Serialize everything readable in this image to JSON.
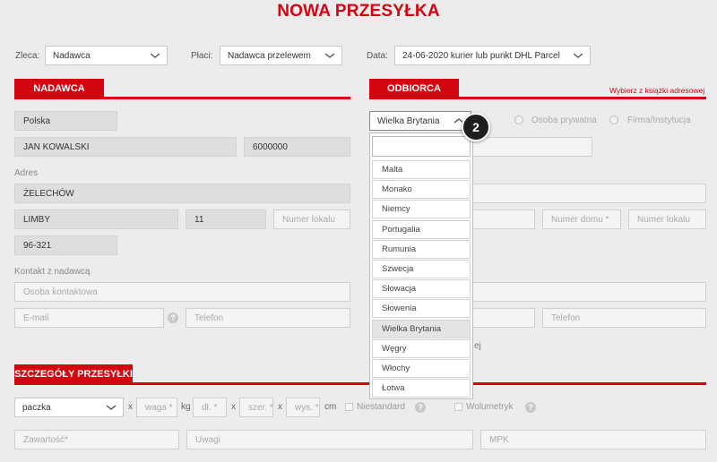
{
  "page_title": "NOWA PRZESYŁKA",
  "top": {
    "zleca_label": "Zleca:",
    "zleca_value": "Nadawca",
    "placi_label": "Płaci:",
    "placi_value": "Nadawca przelewem",
    "data_label": "Data:",
    "data_value": "24-06-2020 kurier lub punkt DHL Parcel"
  },
  "sender": {
    "header": "NADAWCA",
    "country": "Polska",
    "name": "JAN KOWALSKI",
    "phone_short": "6000000",
    "address_label": "Adres",
    "street": "ŻELECHÓW",
    "city": "LIMBY",
    "house_no": "11",
    "flat_placeholder": "Numer lokalu",
    "postal": "96-321",
    "contact_label": "Kontakt z nadawcą",
    "contact_person_placeholder": "Osoba kontaktowa",
    "email_placeholder": "E-mail",
    "phone_placeholder": "Telefon",
    "help_glyph": "?"
  },
  "receiver": {
    "header": "ODBIORCA",
    "address_book_link": "Wybierz z książki adresowej",
    "country_selected": "Wielka Brytania",
    "radio_private": "Osoba prywatna",
    "radio_company": "Firma/Instytucja",
    "house_placeholder": "Numer domu *",
    "flat_placeholder": "Numer lokalu",
    "phone_placeholder": "Telefon",
    "partial_text": "ej"
  },
  "country_dropdown": {
    "search_value": "",
    "options": [
      "Malta",
      "Monako",
      "Niemcy",
      "Portugalia",
      "Rumunia",
      "Szwecja",
      "Słowacja",
      "Słowenia",
      "Wielka Brytania",
      "Węgry",
      "Włochy",
      "Łotwa"
    ],
    "active_index": 8
  },
  "step_badge": "2",
  "details": {
    "header": "SZCZEGÓŁY PRZESYŁKI",
    "type_value": "paczka",
    "x_glyph": "x",
    "weight_placeholder": "waga *",
    "weight_unit": "kg",
    "length_placeholder": "dł. *",
    "width_placeholder": "szer. *",
    "height_placeholder": "wys. *",
    "dim_unit": "cm",
    "nonstandard_label": "Niestandard",
    "volumetric_label": "Wolumetryk",
    "help_glyph": "?",
    "contents_placeholder": "Zawartość*",
    "notes_placeholder": "Uwagi",
    "mpk_placeholder": "MPK"
  },
  "colors": {
    "accent": "#d40511",
    "page_bg": "#ececec"
  }
}
